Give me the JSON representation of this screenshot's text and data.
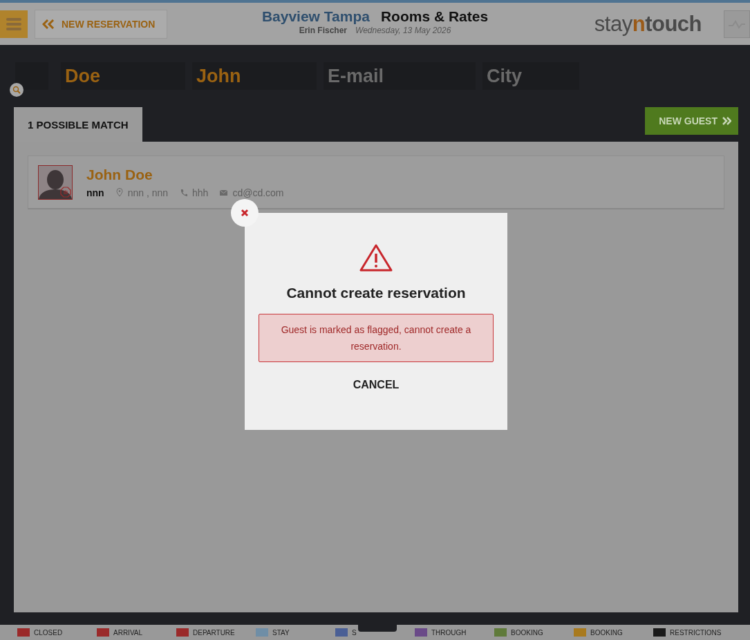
{
  "header": {
    "back_button": "NEW RESERVATION",
    "hotel": "Bayview Tampa",
    "section": "Rooms & Rates",
    "user": "Erin Fischer",
    "date": "Wednesday, 13 May 2026",
    "logo": {
      "prefix": "stay",
      "accent": "n",
      "suffix": "touch"
    }
  },
  "search": [
    {
      "value": "Doe"
    },
    {
      "value": "John"
    },
    {
      "placeholder": "E-mail"
    },
    {
      "placeholder": "City"
    }
  ],
  "tabs": [
    {
      "label": "1 POSSIBLE MATCH",
      "selected": true
    }
  ],
  "new_guest_button": "NEW GUEST",
  "guests": [
    {
      "name": "John Doe",
      "flagged": true,
      "company": "nnn",
      "location": "nnn , nnn",
      "phone": "hhh",
      "email": "cd@cd.com"
    }
  ],
  "legend": [
    {
      "label": "CLOSED",
      "color": "#9a2a2a"
    },
    {
      "label": "ARRIVAL",
      "color": "#9a2a2a"
    },
    {
      "label": "DEPARTURE",
      "color": "#9a2a2a"
    },
    {
      "label": "STAY",
      "color": "#6f8ea6"
    },
    {
      "label": "S",
      "color": "#4a5f95"
    },
    {
      "label": "THROUGH",
      "color": "#6a4a88"
    },
    {
      "label": "BOOKING",
      "color": "#5f7a3a"
    },
    {
      "label": "BOOKING",
      "color": "#a87a1e"
    },
    {
      "label": "RESTRICTIONS",
      "color": "#1a1a1a"
    }
  ],
  "dialog": {
    "title": "Cannot create reservation",
    "message": "Guest is marked as flagged, cannot create a reservation.",
    "cancel": "CANCEL"
  }
}
